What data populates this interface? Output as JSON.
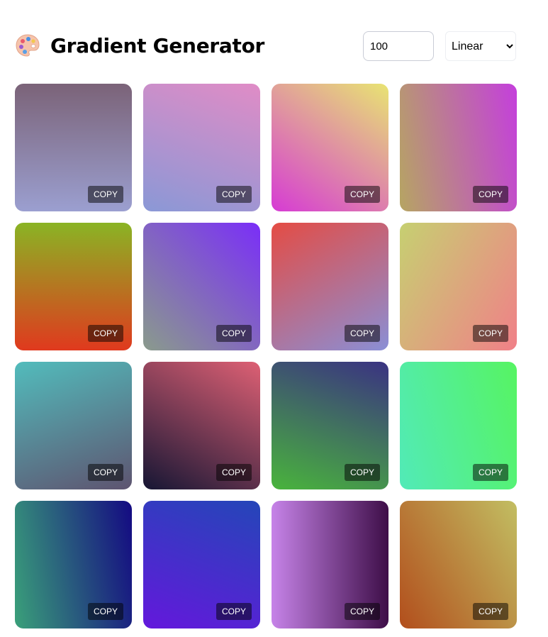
{
  "header": {
    "title": "Gradient Generator",
    "icon": "palette-icon"
  },
  "controls": {
    "count_value": "100",
    "type_options": [
      "Linear"
    ],
    "type_selected": "Linear"
  },
  "cards": [
    {
      "gradient": "linear-gradient(180deg, #7b6378 0%, #9b9fd0 100%)",
      "copy_label": "COPY"
    },
    {
      "gradient": "linear-gradient(200deg, #e08cc6 0%, #8a98d6 100%)",
      "copy_label": "COPY"
    },
    {
      "gradient": "linear-gradient(215deg, #e8e472 0%, #d63bd4 100%)",
      "copy_label": "COPY"
    },
    {
      "gradient": "linear-gradient(260deg, #c43fdc 0%, #b6a562 100%)",
      "copy_label": "COPY"
    },
    {
      "gradient": "linear-gradient(180deg, #8ab424 0%, #e0391e 100%)",
      "copy_label": "COPY"
    },
    {
      "gradient": "linear-gradient(225deg, #7a2ef8 0%, #8a9b8c 100%)",
      "copy_label": "COPY"
    },
    {
      "gradient": "linear-gradient(150deg, #e44c44 0%, #8a8fd6 100%)",
      "copy_label": "COPY"
    },
    {
      "gradient": "linear-gradient(120deg, #c6d071 0%, #f08088 100%)",
      "copy_label": "COPY"
    },
    {
      "gradient": "linear-gradient(160deg, #52bcbc 0%, #5e5470 100%)",
      "copy_label": "COPY"
    },
    {
      "gradient": "linear-gradient(30deg, #161634 0%, #de6074 100%)",
      "copy_label": "COPY"
    },
    {
      "gradient": "linear-gradient(200deg, #3a3282 0%, #49b43c 100%)",
      "copy_label": "COPY"
    },
    {
      "gradient": "linear-gradient(75deg, #52eab8 0%, #56f462 100%)",
      "copy_label": "COPY"
    },
    {
      "gradient": "linear-gradient(80deg, #3aa07a 0%, #140a82 100%)",
      "copy_label": "COPY"
    },
    {
      "gradient": "linear-gradient(20deg, #6418dc 0%, #2446b8 100%)",
      "copy_label": "COPY"
    },
    {
      "gradient": "linear-gradient(90deg, #c683e8 0%, #3e0e48 100%)",
      "copy_label": "COPY"
    },
    {
      "gradient": "linear-gradient(60deg, #b24e1c 0%, #c2be62 100%)",
      "copy_label": "COPY"
    }
  ]
}
